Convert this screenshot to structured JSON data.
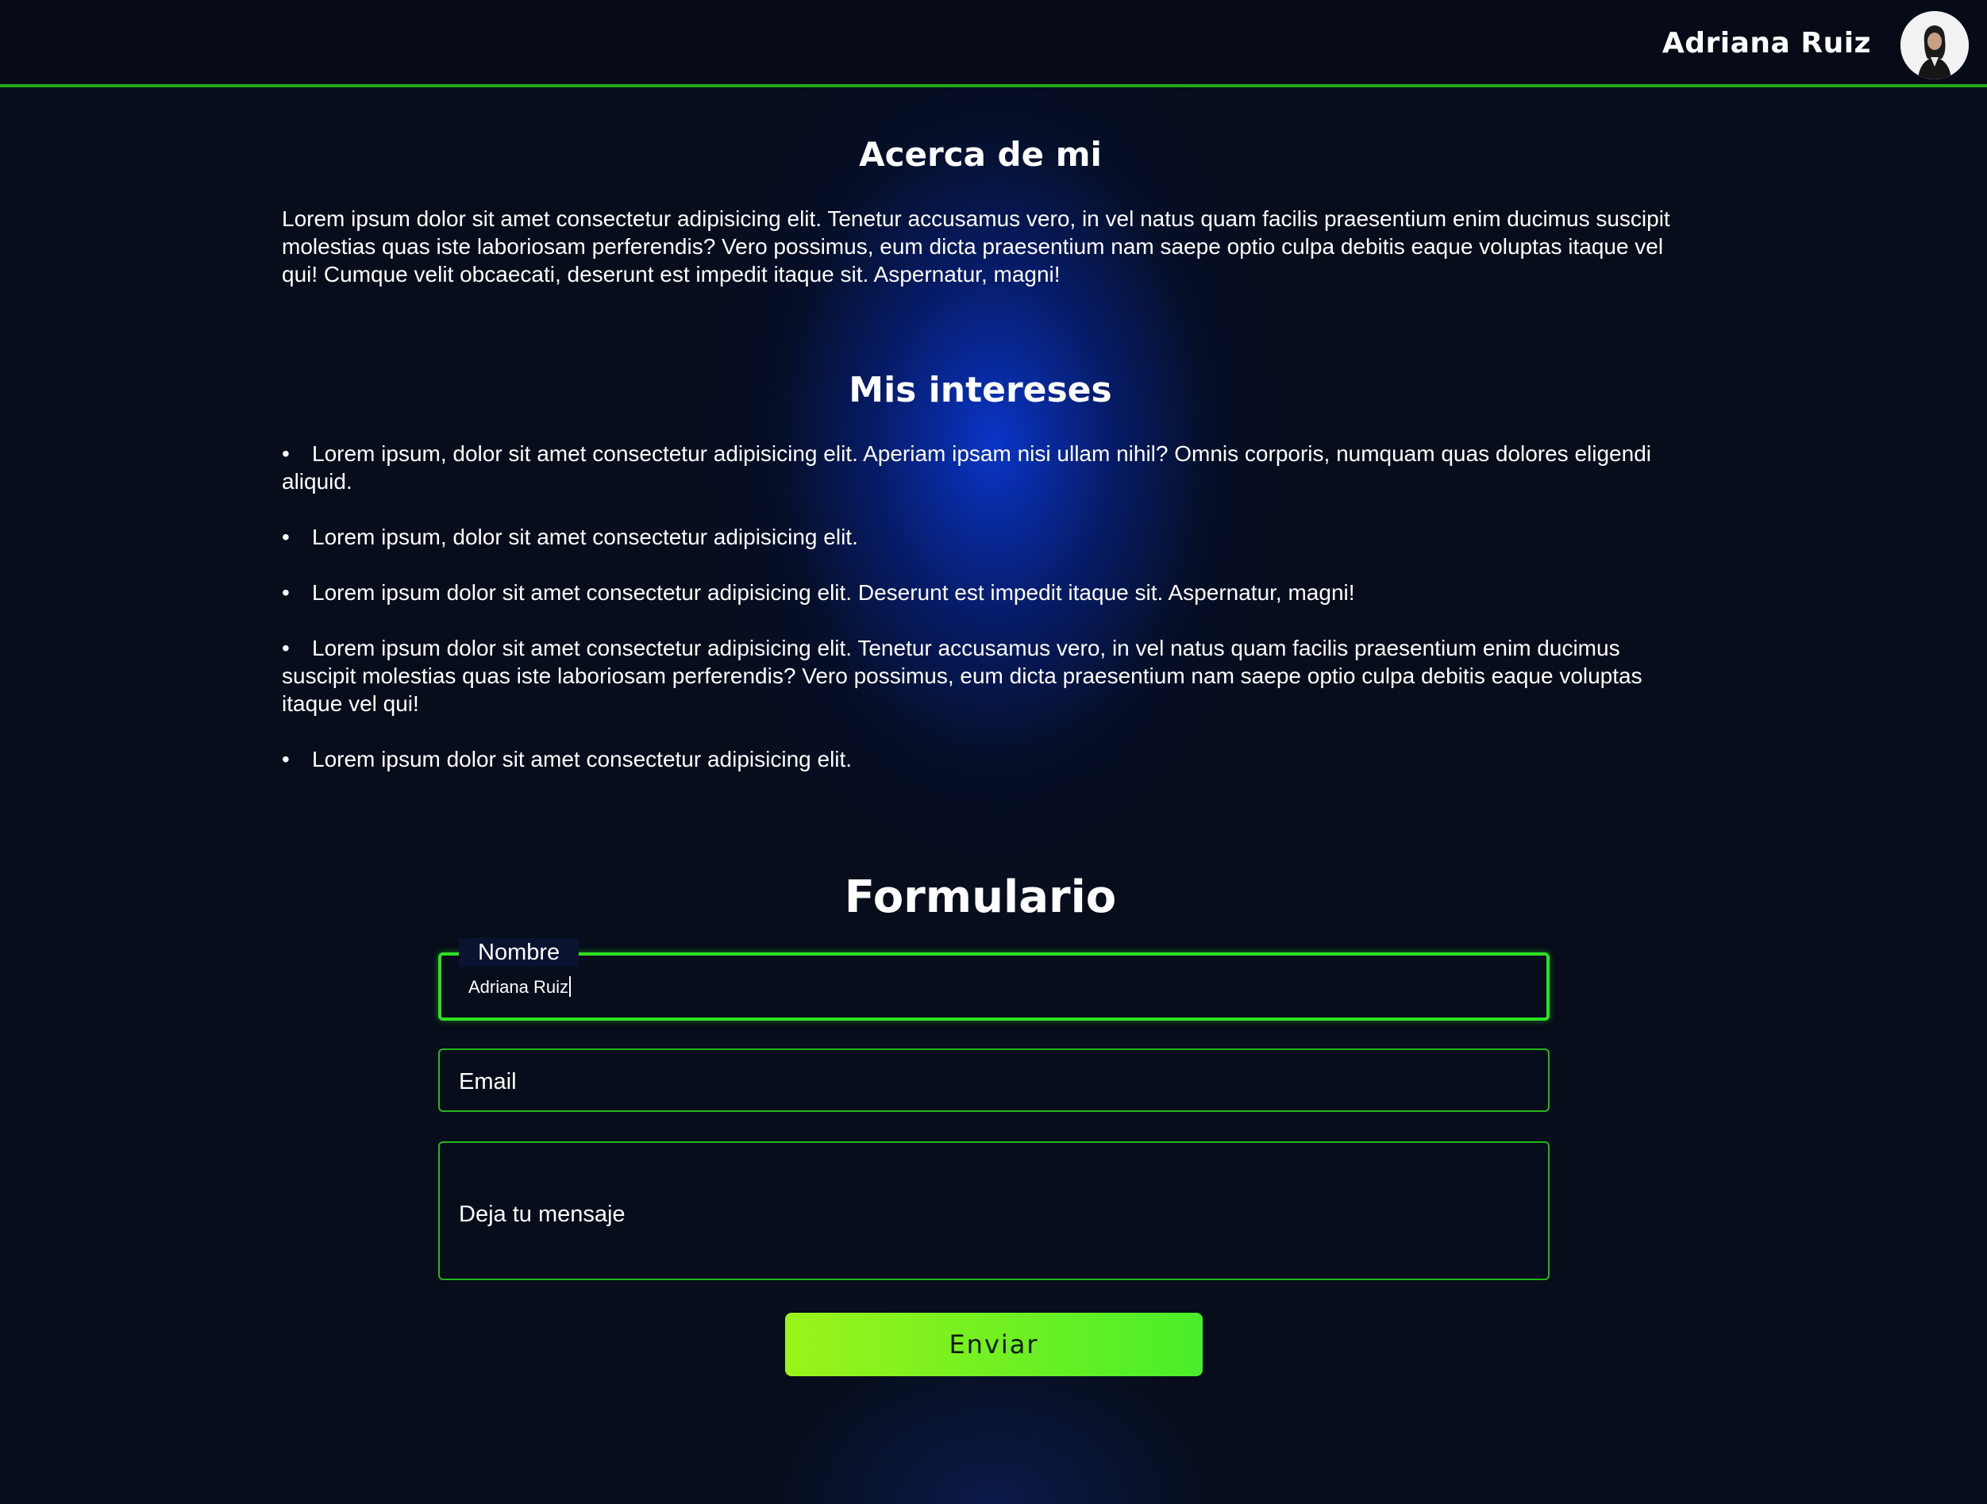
{
  "header": {
    "user_name": "Adriana Ruiz",
    "avatar_icon": "user-avatar"
  },
  "about": {
    "title": "Acerca de mi",
    "text": "Lorem ipsum dolor sit amet consectetur adipisicing elit. Tenetur accusamus vero, in vel natus quam facilis praesentium enim ducimus suscipit molestias quas iste laboriosam perferendis? Vero possimus, eum dicta praesentium nam saepe optio culpa debitis eaque voluptas itaque vel qui! Cumque velit obcaecati, deserunt est impedit itaque sit. Aspernatur, magni!"
  },
  "interests": {
    "title": "Mis intereses",
    "items": [
      "Lorem ipsum, dolor sit amet consectetur adipisicing elit. Aperiam ipsam nisi ullam nihil? Omnis corporis, numquam quas dolores eligendi aliquid.",
      "Lorem ipsum, dolor sit amet consectetur adipisicing elit.",
      "Lorem ipsum dolor sit amet consectetur adipisicing elit. Deserunt est impedit itaque sit. Aspernatur, magni!",
      "Lorem ipsum dolor sit amet consectetur adipisicing elit. Tenetur accusamus vero, in vel natus quam facilis praesentium enim ducimus suscipit molestias quas iste laboriosam perferendis? Vero possimus, eum dicta praesentium nam saepe optio culpa debitis eaque voluptas itaque vel qui!",
      "Lorem ipsum dolor sit amet consectetur adipisicing elit."
    ]
  },
  "form": {
    "title": "Formulario",
    "name_label": "Nombre",
    "name_value": "Adriana Ruiz",
    "email_placeholder": "Email",
    "message_placeholder": "Deja tu mensaje",
    "submit_label": "Enviar"
  },
  "colors": {
    "background": "#070d1a",
    "accent_green": "#22b81c",
    "button_start": "#9bf31a",
    "button_end": "#49ee2a",
    "glow_blue": "#0a3ce6"
  }
}
